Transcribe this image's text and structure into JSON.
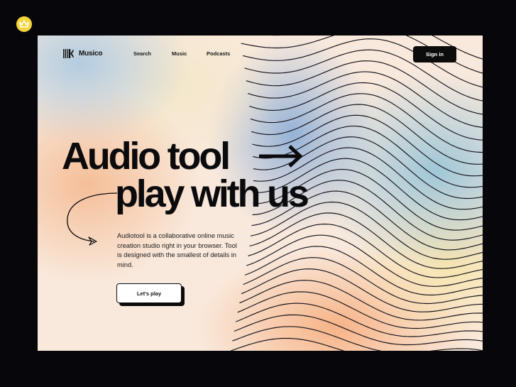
{
  "brand": {
    "name": "Musico",
    "logo_icon": "musico-logo-icon"
  },
  "nav": {
    "items": [
      {
        "label": "Search"
      },
      {
        "label": "Music"
      },
      {
        "label": "Podcasts"
      }
    ],
    "sign_in_label": "Sign in"
  },
  "hero": {
    "headline_line1": "Audio tool",
    "headline_line2": "play with us",
    "arrow_icon": "arrow-right-icon",
    "description": "Audiotool is a collaborative online music creation studio right in your browser. Tool is designed with the smallest of details in mind.",
    "cta_label": "Let's play"
  },
  "decor": {
    "badge_icon": "crown-icon",
    "curl_icon": "curly-arrow-icon",
    "waves": "wavy-lines-illustration"
  },
  "colors": {
    "page_bg": "#07070b",
    "ink": "#0b0b0e",
    "badge": "#f3d53a",
    "card_base": "#f9e9dc",
    "gradient_blue": "#84a9d6",
    "gradient_peach": "#f6aa78",
    "gradient_cream": "#f8e4aa"
  }
}
